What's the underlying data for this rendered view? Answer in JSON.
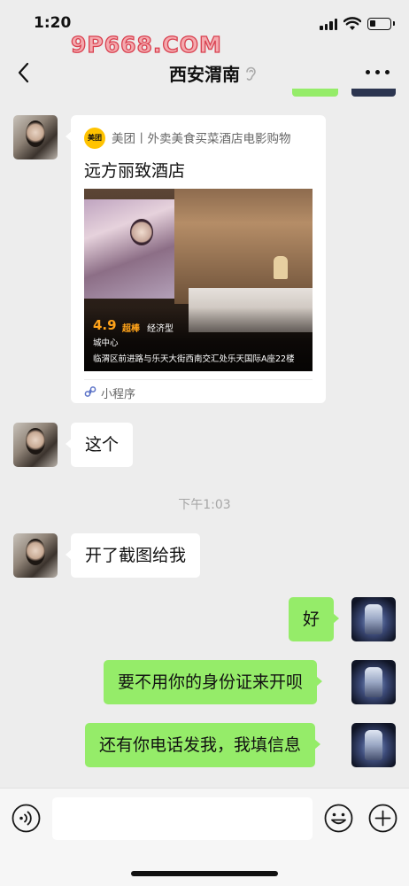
{
  "status_bar": {
    "time": "1:20"
  },
  "watermark": {
    "text": "9P668.COM"
  },
  "nav": {
    "title": "西安渭南"
  },
  "messages": {
    "card": {
      "source": "美团丨外卖美食买菜酒店电影购物",
      "logo_text": "美团",
      "title": "远方丽致酒店",
      "rating": "4.9",
      "badge_best": "超棒",
      "badge_type": "经济型",
      "district": "城中心",
      "address": "临渭区前进路与乐天大街西南交汇处乐天国际A座22楼",
      "footer": "小程序"
    },
    "msg1": "这个",
    "time_divider": "下午1:03",
    "msg2": "开了截图给我",
    "msg3": "好",
    "msg4": "要不用你的身份证来开呗",
    "msg5": "还有你电话发我，我填信息"
  },
  "input_bar": {
    "value": ""
  },
  "colors": {
    "outgoing_bubble": "#95ec69",
    "incoming_bubble": "#ffffff",
    "background": "#ededed",
    "rating": "#ffa31a",
    "meituan_logo": "#ffc300"
  },
  "icons": [
    "back-icon",
    "ear-icon",
    "more-icon",
    "voice-icon",
    "emoji-icon",
    "plus-icon",
    "mini-program-icon"
  ]
}
